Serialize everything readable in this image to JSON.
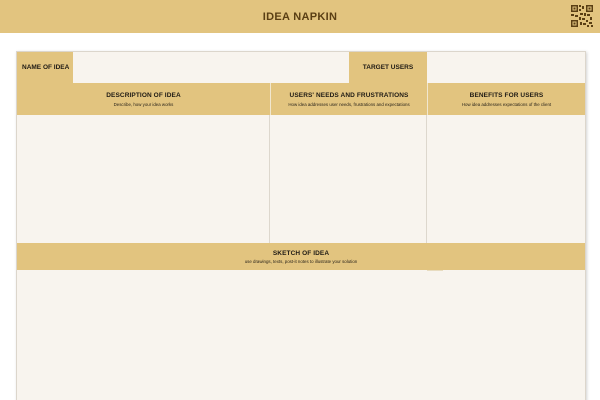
{
  "header": {
    "title": "IDEA NAPKIN"
  },
  "fields": {
    "name_of_idea": "NAME OF IDEA",
    "target_users": "TARGET USERS"
  },
  "sections": {
    "description": {
      "title": "DESCRIPTION OF IDEA",
      "subtitle": "Describe, how your idea works"
    },
    "needs": {
      "title": "USERS' NEEDS AND FRUSTRATIONS",
      "subtitle": "How idea addresses user needs, frustrations and expectations"
    },
    "benefits": {
      "title": "BENEFITS FOR USERS",
      "subtitle": "How idea addresses expectations of the client"
    },
    "sketch": {
      "title": "SKETCH OF IDEA",
      "subtitle": "use drawings, texts, post-it notes to illustrate your solution"
    }
  },
  "colors": {
    "accent": "#e2c47f",
    "sheet": "#f8f4ee",
    "title_text": "#5a3f14"
  },
  "icons": {
    "corner": "qr-code-icon"
  }
}
